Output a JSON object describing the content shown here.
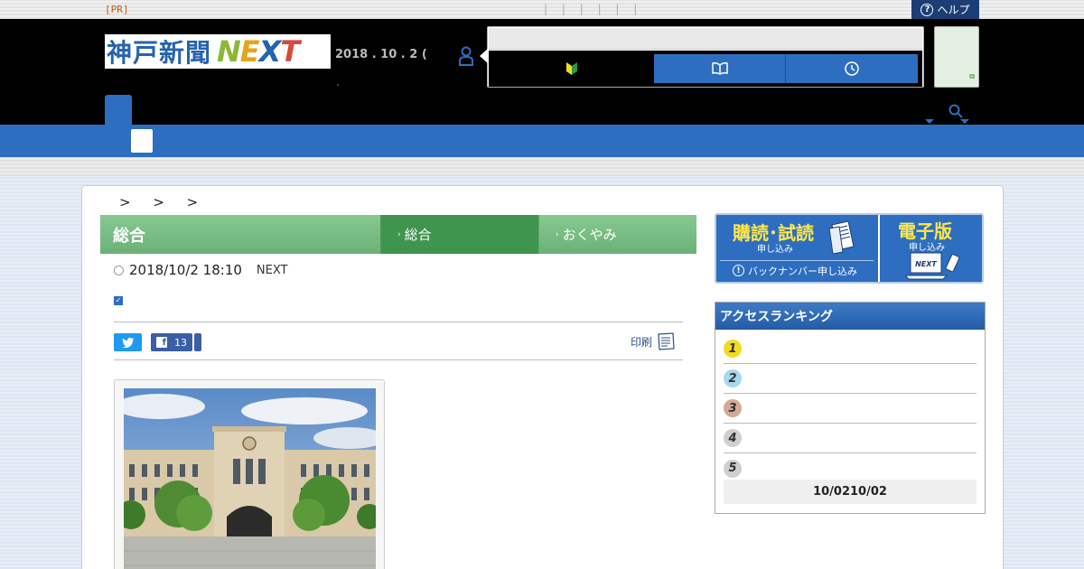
{
  "topbar": {
    "pr": "[PR]",
    "pipes": "| | | | | |",
    "help": "ヘルプ",
    "help_icon": "question-circle-icon"
  },
  "header": {
    "logo_kanji": "神戸新聞",
    "logo_next": [
      "N",
      "E",
      "X",
      "T"
    ],
    "date": "2018 . 10 . 2 (",
    "tick": "`",
    "nav_icons": [
      "beginner-mark-icon",
      "book-icon",
      "clock-icon"
    ],
    "colors": {
      "accent_blue": "#2e6ec0",
      "dark_blue": "#1c3e74"
    }
  },
  "breadcrumb": "> > >",
  "category": {
    "main": "総合",
    "tabs": [
      {
        "label": "総合",
        "active": true
      },
      {
        "label": "おくやみ",
        "active": false
      }
    ]
  },
  "article": {
    "datetime": "2018/10/2 18:10",
    "source": "NEXT",
    "fb_count": "13",
    "print_label": "印刷"
  },
  "sidebar": {
    "banner": {
      "subscribe": "購読･試読",
      "subscribe_sub": "申し込み",
      "back_number": "バックナンバー申し込み",
      "digital": "電子版",
      "digital_sub": "申し込み",
      "device_label": "NEXT"
    },
    "ranking": {
      "title": "アクセスランキング",
      "items": [
        "1",
        "2",
        "3",
        "4",
        "5"
      ],
      "footer": "10/0210/02"
    }
  }
}
